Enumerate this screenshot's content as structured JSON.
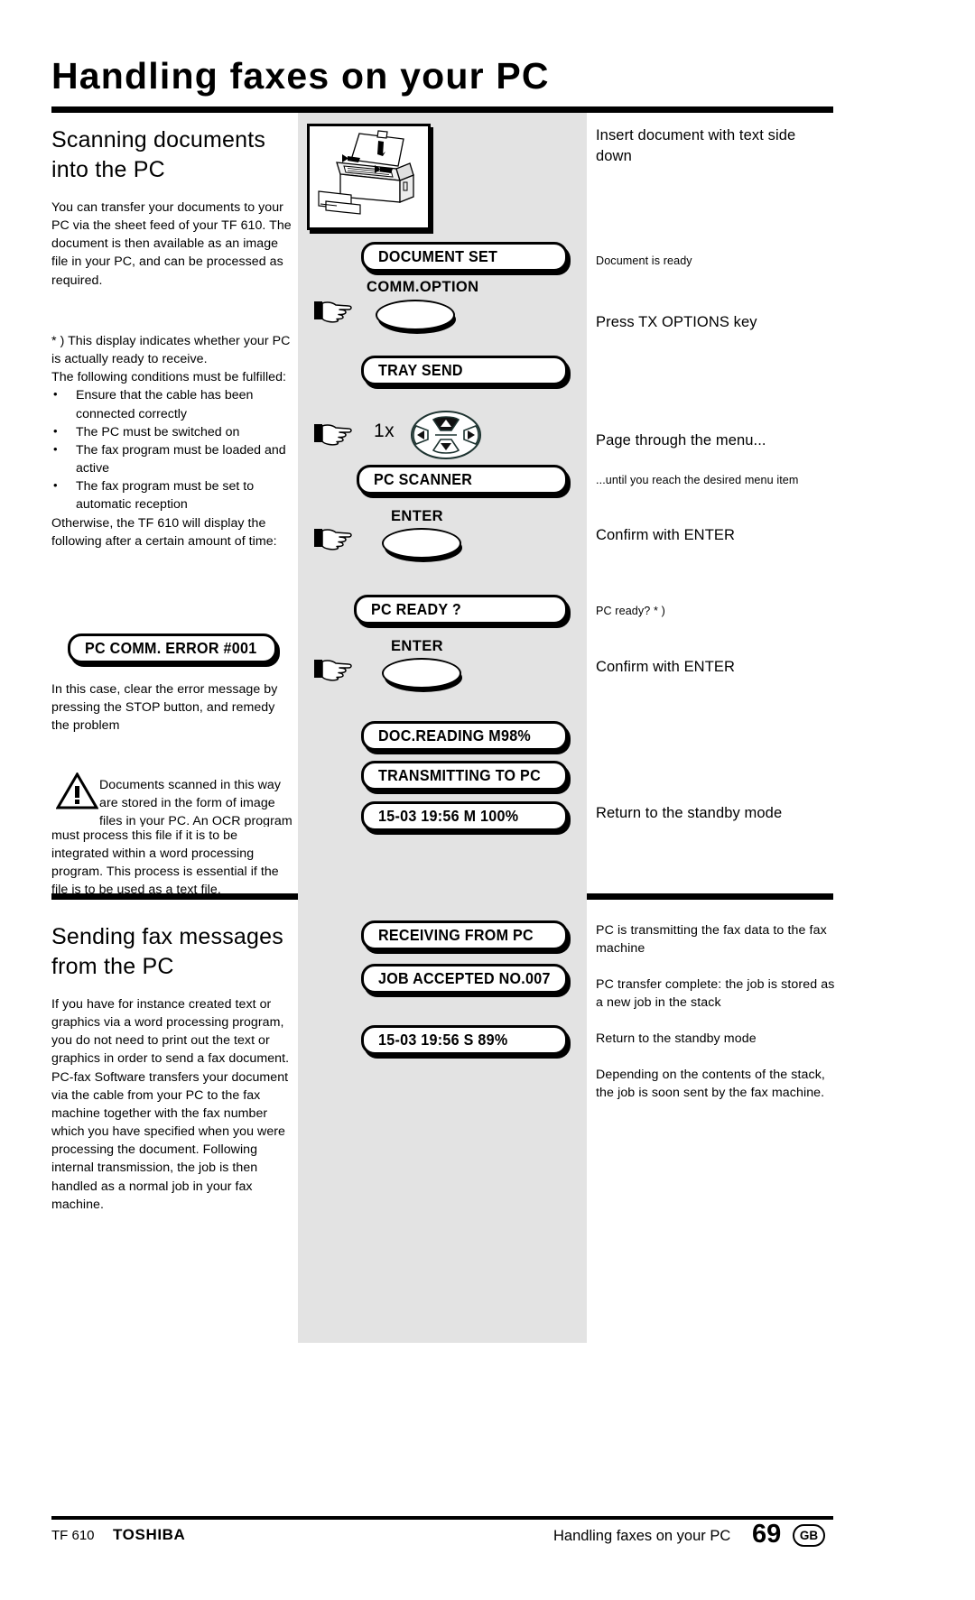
{
  "header": {
    "title": "Handling faxes on your PC"
  },
  "section1": {
    "heading_line1": "Scanning documents",
    "heading_line2": "into the PC",
    "intro": "You can transfer your documents to your PC via the sheet feed of your TF 610. The document is then available as an image file in your PC, and can be processed as required.",
    "footnote_line1": "* ) This display indicates whether your PC is actually ready to receive.",
    "footnote_line2": "The following conditions must be fulfilled:",
    "conditions": [
      "Ensure that the cable has been connected correctly",
      "The PC must be switched on",
      "The fax program must be loaded and active",
      "The fax program must be set to automatic reception"
    ],
    "otherwise": "Otherwise, the TF 610 will display the following after a certain amount of time:",
    "error_display": "PC COMM. ERROR  #001",
    "after_error": "In this case, clear the error message by pressing the STOP button, and remedy the problem",
    "warning": "Documents scanned in this way are stored in the form of image files in your PC. An OCR program must process this file if it is to be integrated within a word processing program. This process is essential if the file is to be used as a text file."
  },
  "section2": {
    "heading_line1": "Sending  fax  messages",
    "heading_line2": "from the PC",
    "body": "If you have for instance created text or graphics via a word processing program, you do not need to print out the text or graphics in order to send a fax document. PC-fax Software transfers your document via the cable from your PC to the fax machine together with the fax number which you have specified when you were processing the document. Following internal transmission, the job is then handled as a normal job in your fax machine."
  },
  "steps": {
    "illustration_caption": "fax-machine-document-insert",
    "display_document_set": "DOCUMENT SET",
    "key_comm_option": "COMM.OPTION",
    "display_tray_send": "TRAY SEND",
    "repeat_count": "1x",
    "display_pc_scanner": "PC SCANNER",
    "key_enter_1": "ENTER",
    "display_pc_ready": "PC READY ?",
    "key_enter_2": "ENTER",
    "display_doc_reading": "DOC.READING    M98%",
    "display_transmitting": "TRANSMITTING TO PC",
    "display_standby_1": "15-03 19:56  M 100%",
    "display_receiving": "RECEIVING FROM PC",
    "display_job_accepted": "JOB ACCEPTED NO.007",
    "display_standby_2": "15-03 19:56  S 89%"
  },
  "annotations": {
    "insert_document": "Insert document with text side down",
    "document_ready": "Document is ready",
    "press_tx_options": "Press TX OPTIONS key",
    "page_through": "Page through the menu...",
    "until_reach": "...until you reach the desired menu item",
    "confirm_enter_1": "Confirm with ENTER",
    "pc_ready_note": "PC ready? * )",
    "confirm_enter_2": "Confirm with ENTER",
    "return_standby_1": "Return to the standby mode",
    "pc_transmitting": "PC is transmitting the fax data to the fax machine",
    "pc_transfer_complete": "PC transfer complete: the job is stored as a new job in the stack",
    "return_standby_2": "Return to the standby mode",
    "depending_stack": "Depending on the contents of the stack, the job is soon sent by the fax machine."
  },
  "footer": {
    "model": "TF 610",
    "brand": "TOSHIBA",
    "center": "Handling faxes on your PC",
    "page": "69",
    "locale": "GB"
  }
}
